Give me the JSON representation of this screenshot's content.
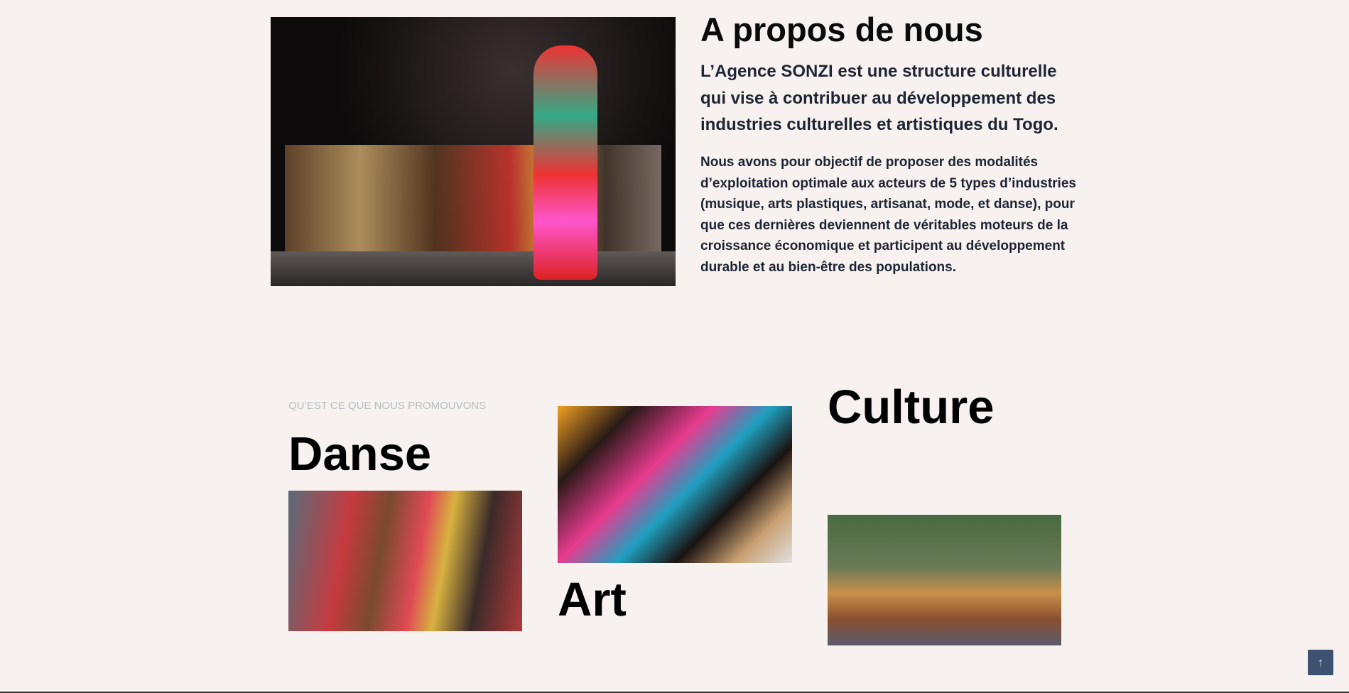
{
  "about": {
    "heading": "A propos de nous",
    "lead": "L’Agence SONZI est une structure culturelle qui vise à contribuer au développement des industries culturelles et artistiques du Togo.",
    "body": "Nous avons pour objectif de proposer des modalités d’exploitation optimale aux acteurs de 5 types d’industries (musique, arts plastiques, artisanat, mode, et danse), pour que ces dernières deviennent de véritables moteurs de la croissance économique et participent au développement durable et au bien-être des populations."
  },
  "promote": {
    "eyebrow": "QU’EST CE QUE NOUS PROMOUVONS",
    "items": [
      {
        "title": "Danse"
      },
      {
        "title": "Art"
      },
      {
        "title": "Culture"
      }
    ]
  },
  "scroll_top": {
    "icon": "arrow-up-icon",
    "glyph": "↑",
    "color": "#3d5170"
  }
}
